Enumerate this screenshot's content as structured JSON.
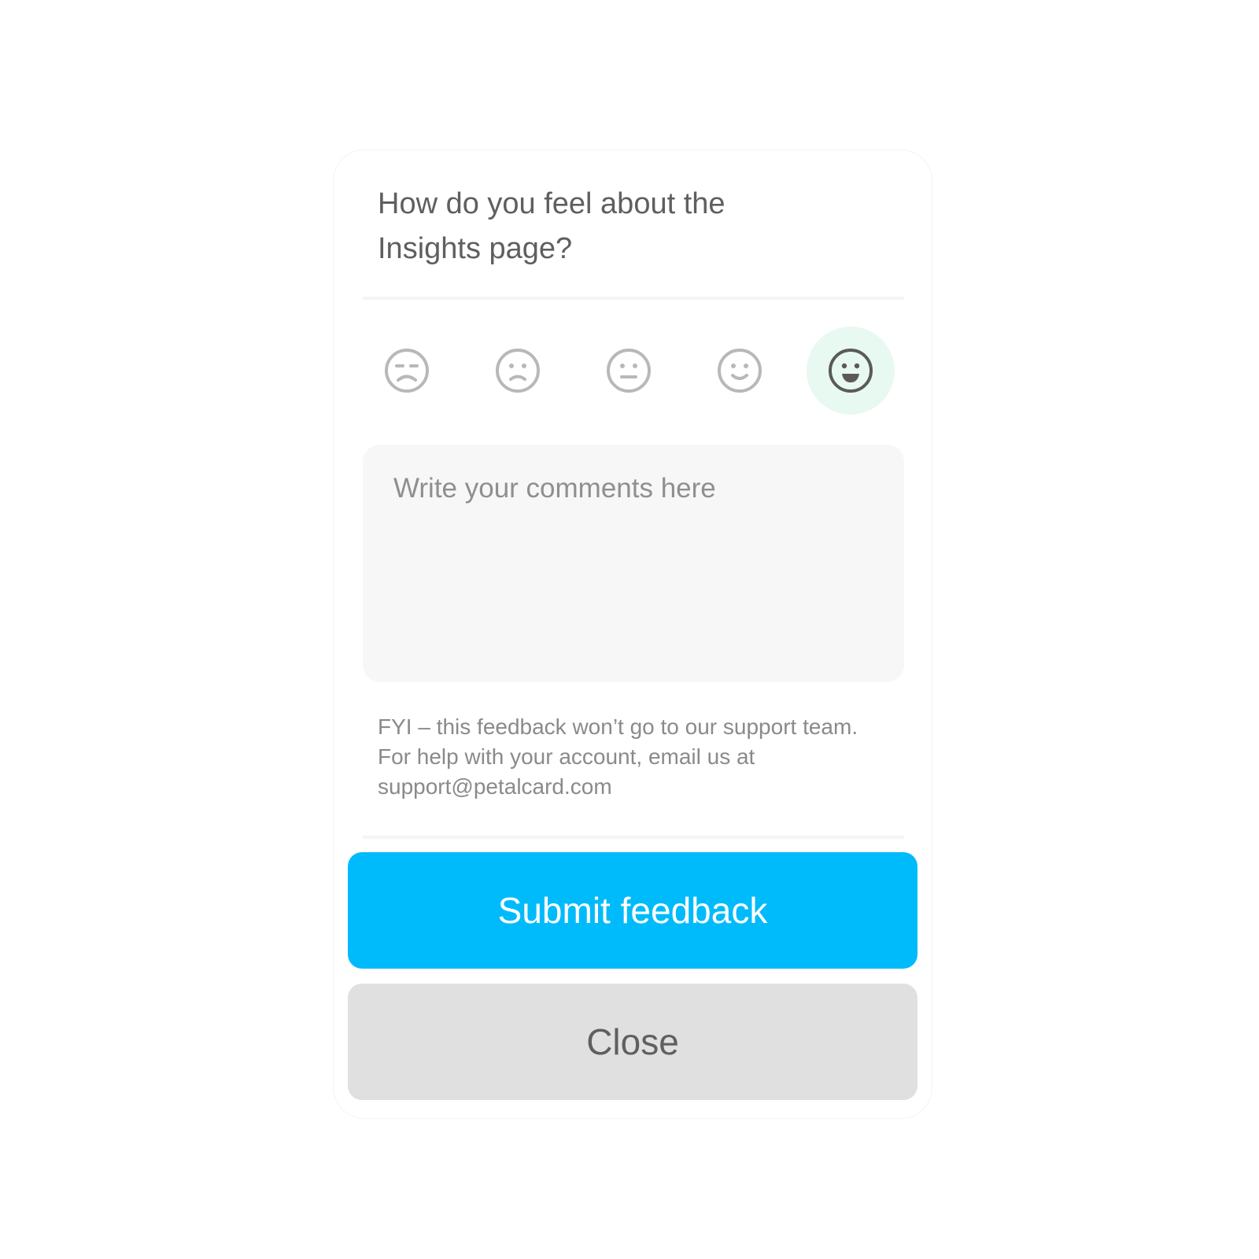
{
  "question": "How do you feel about the Insights page?",
  "ratings": [
    {
      "icon": "very-dissatisfied-face-icon",
      "selected": false
    },
    {
      "icon": "dissatisfied-face-icon",
      "selected": false
    },
    {
      "icon": "neutral-face-icon",
      "selected": false
    },
    {
      "icon": "satisfied-face-icon",
      "selected": false
    },
    {
      "icon": "very-satisfied-face-icon",
      "selected": true
    }
  ],
  "comments": {
    "value": "",
    "placeholder": "Write your comments here"
  },
  "note": "FYI – this feedback won’t go to our support team. For help with your account, email us at support@petalcard.com",
  "buttons": {
    "submit_label": "Submit feedback",
    "close_label": "Close"
  },
  "colors": {
    "accent": "#00bbfb",
    "selected_bg": "#e8f9f1",
    "close_bg": "#e0e0e0",
    "icon_inactive": "#b8b8b8",
    "icon_active": "#5a5a5a"
  }
}
